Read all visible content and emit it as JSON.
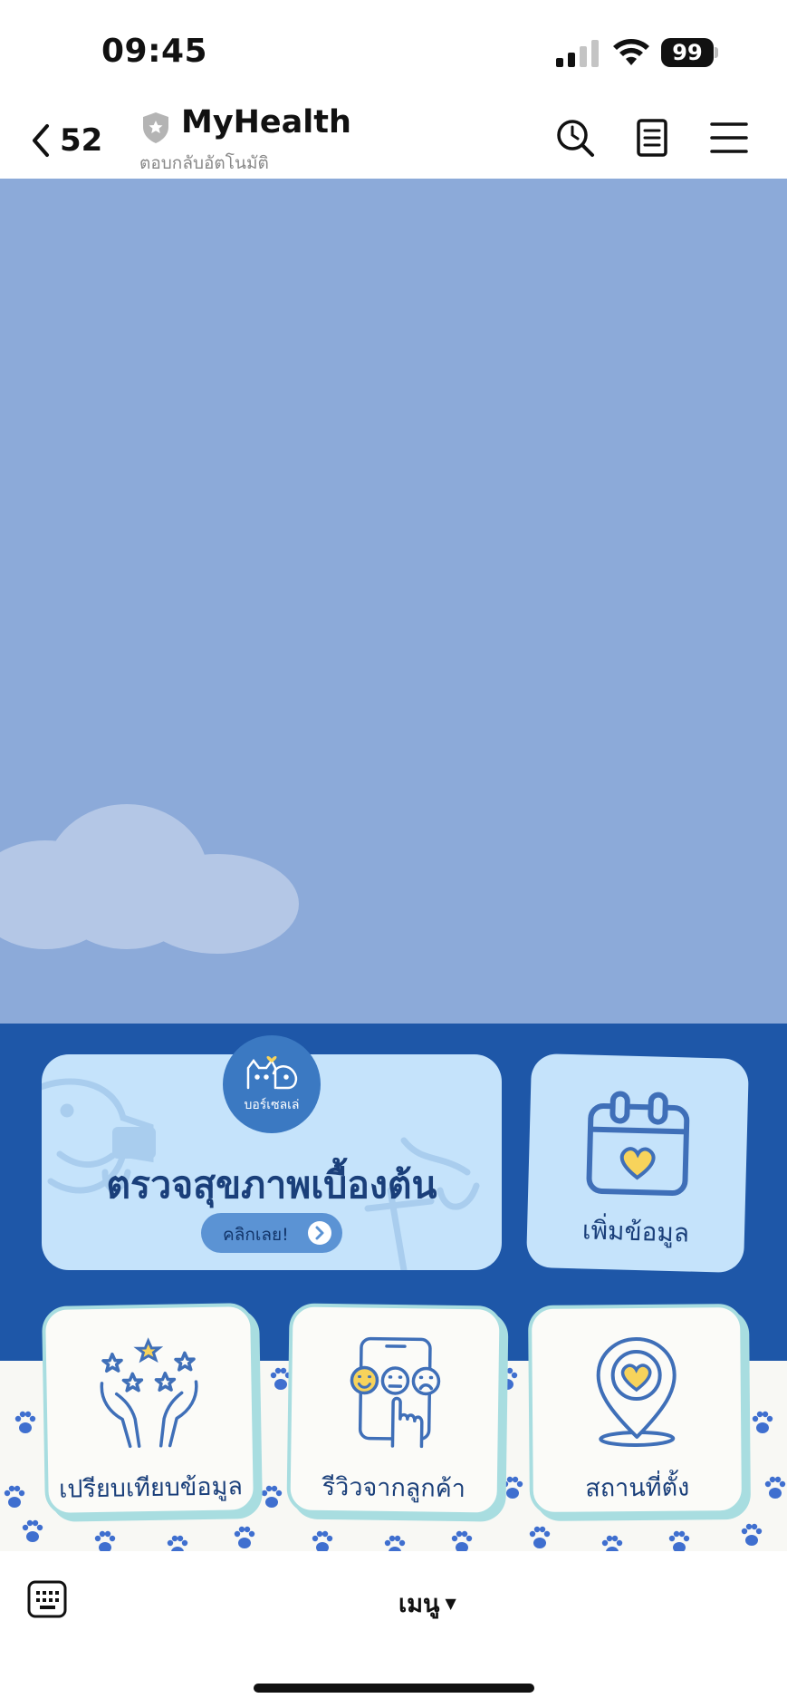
{
  "status_bar": {
    "time": "09:45",
    "battery": "99"
  },
  "header": {
    "back_count": "52",
    "title": "MyHealth",
    "subtitle": "ตอบกลับอัตโนมัติ"
  },
  "rich_menu": {
    "logo_text": "บอร์เซลเล่",
    "main_card": {
      "title": "ตรวจสุขภาพเบื้องต้น",
      "button": "คลิกเลย!"
    },
    "add_card": "เพิ่มข้อมูล",
    "compare_card": "เปรียบเทียบข้อมูล",
    "review_card": "รีวิวจากลูกค้า",
    "location_card": "สถานที่ตั้ง"
  },
  "bottom_bar": {
    "menu_label": "เมนู"
  },
  "colors": {
    "chat_background": "#8caad9",
    "rich_menu_blue": "#1e57a8",
    "card_light_blue": "#c5e3fb",
    "card_border_teal": "#a8dde0",
    "heart_yellow": "#f7d35b",
    "paw_blue": "#3f6fcf"
  }
}
